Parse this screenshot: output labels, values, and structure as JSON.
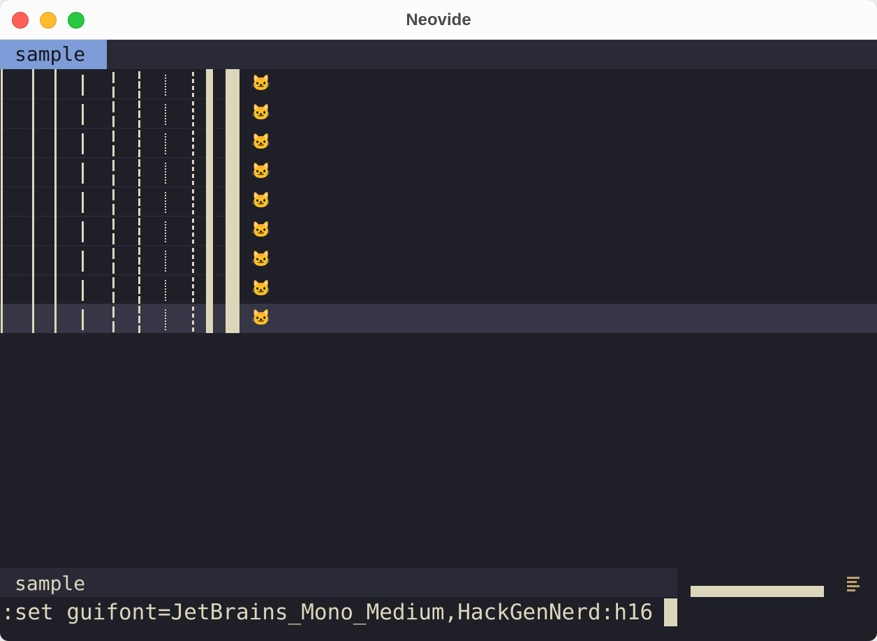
{
  "window": {
    "title": "Neovide"
  },
  "tabline": {
    "active_tab": "sample"
  },
  "buffer": {
    "line_count": 9,
    "cursor_line_index": 8,
    "line_glyph_icon": "cat-icon",
    "line_glyph": "🐱",
    "colors": {
      "background": "#1f1f28",
      "foreground": "#dcd7ba",
      "cursorline": "#363646",
      "tab_active": "#7e9cd8"
    }
  },
  "statusline": {
    "filename": "sample",
    "progress_icon": "menu-icon"
  },
  "cmdline": {
    "text": ":set guifont=JetBrains_Mono_Medium,HackGenNerd:h16"
  }
}
